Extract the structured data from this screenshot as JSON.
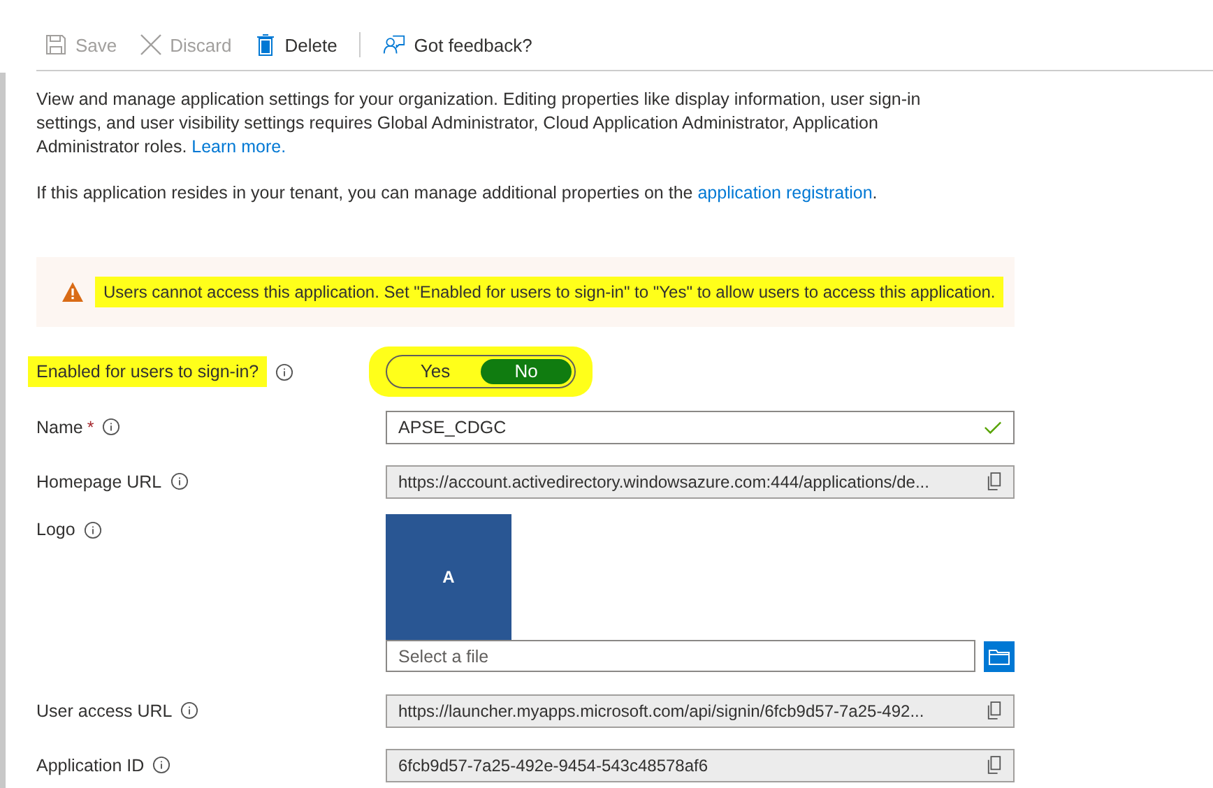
{
  "toolbar": [
    {
      "label": "Save",
      "kind": "save",
      "disabled": true
    },
    {
      "label": "Discard",
      "kind": "discard",
      "disabled": true
    },
    {
      "label": "Delete",
      "kind": "delete",
      "disabled": false
    },
    {
      "label": "Got feedback?",
      "kind": "feedback",
      "disabled": false
    }
  ],
  "intro": {
    "text": "View and manage application settings for your organization. Editing properties like display information, user sign-in settings, and user visibility settings requires Global Administrator, Cloud Application Administrator, Application Administrator roles.",
    "link": "Learn more."
  },
  "registration": {
    "text": "If this application resides in your tenant, you can manage additional properties on the",
    "link": "application registration",
    "end": "."
  },
  "warning": {
    "text": "Users cannot access this application. Set \"Enabled for users to sign-in\" to \"Yes\" to allow users to access this application.",
    "highlighted": true
  },
  "sign_in": {
    "label": "Enabled for users to sign-in?",
    "highlighted": true,
    "options": [
      {
        "label": "Yes",
        "selected": false
      },
      {
        "label": "No",
        "selected": true
      }
    ]
  },
  "fields": [
    {
      "kind": "text",
      "label": "Name",
      "required_mark": "*",
      "value": "APSE_CDGC",
      "valid": true
    },
    {
      "kind": "readonly",
      "label": "Homepage URL",
      "value": "https://account.activedirectory.windowsazure.com:444/applications/de..."
    },
    {
      "kind": "logo",
      "label": "Logo",
      "letter": "A",
      "placeholder": "Select a file"
    },
    {
      "kind": "readonly",
      "label": "User access URL",
      "value": "https://launcher.myapps.microsoft.com/api/signin/6fcb9d57-7a25-492..."
    },
    {
      "kind": "readonly",
      "label": "Application ID",
      "value": "6fcb9d57-7a25-492e-9454-543c48578af6"
    }
  ]
}
